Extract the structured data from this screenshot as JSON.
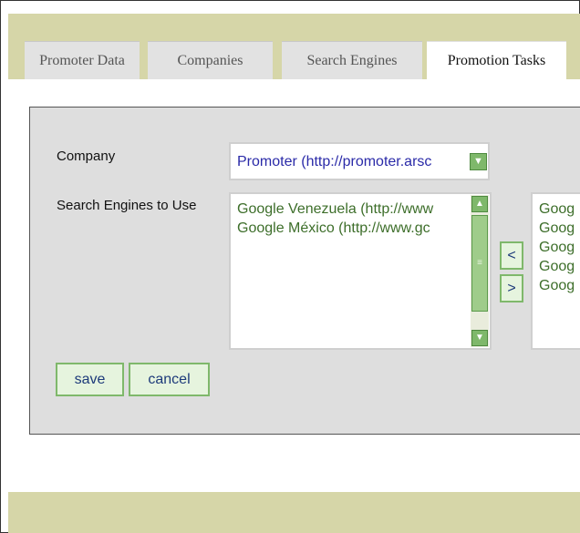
{
  "tabs": [
    {
      "label": "Promoter Data",
      "active": false
    },
    {
      "label": "Companies",
      "active": false
    },
    {
      "label": "Search Engines",
      "active": false
    },
    {
      "label": "Promotion Tasks",
      "active": true
    }
  ],
  "form": {
    "company_label": "Company",
    "company_value": "Promoter (http://promoter.arsc",
    "engines_label": "Search Engines to Use",
    "available_engines": [
      "Google Venezuela (http://www",
      "Google México (http://www.gc"
    ],
    "selected_engines": [
      "Goog",
      "Goog",
      "Goog",
      "Goog",
      "Goog"
    ],
    "move_left_label": "<",
    "move_right_label": ">",
    "save_label": "save",
    "cancel_label": "cancel"
  },
  "colors": {
    "band": "#d6d6a8",
    "panel": "#dedede",
    "accent_green": "#7fb86b",
    "list_text": "#3d6e2a",
    "select_text": "#2a2aa8"
  }
}
